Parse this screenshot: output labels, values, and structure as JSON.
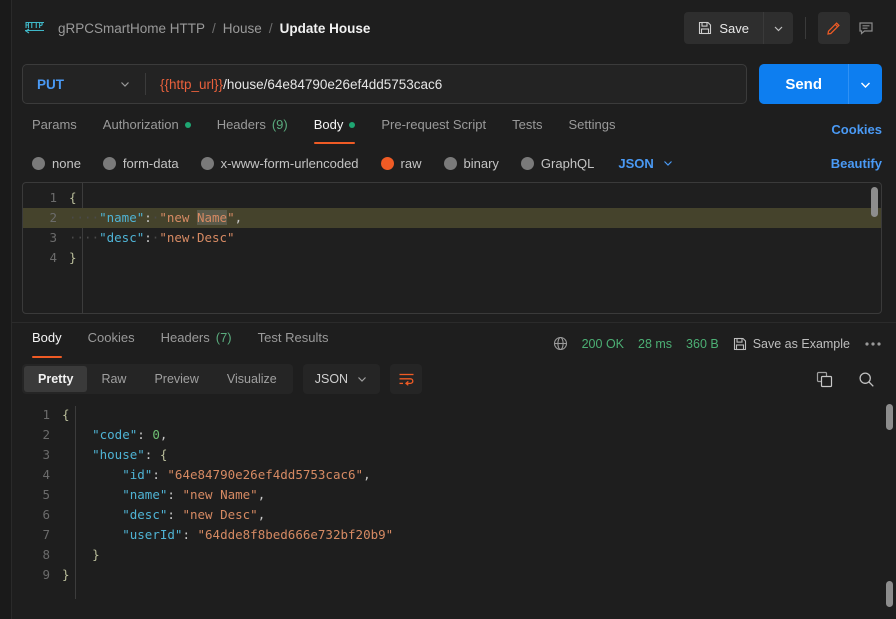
{
  "header": {
    "protocol_icon": "http-icon",
    "breadcrumb": [
      {
        "label": "gRPCSmartHome HTTP",
        "current": false
      },
      {
        "label": "House",
        "current": false
      },
      {
        "label": "Update House",
        "current": true
      }
    ],
    "separator": "/",
    "save_label": "Save",
    "save_icon": "floppy-disk-icon",
    "save_caret_icon": "chevron-down-icon",
    "edit_icon": "pencil-icon",
    "comment_icon": "comment-icon",
    "accent_orange": "#ef5b25",
    "accent_blue": "#0d7ef0"
  },
  "request": {
    "method": "PUT",
    "method_caret_icon": "chevron-down-icon",
    "url_variable": "{{http_url}}",
    "url_path": "/house/64e84790e26ef4dd5753cac6",
    "url_full": "{{http_url}}/house/64e84790e26ef4dd5753cac6",
    "send_label": "Send",
    "send_caret_icon": "chevron-down-icon",
    "tabs": [
      {
        "label": "Params",
        "active": false,
        "dot": false,
        "count": ""
      },
      {
        "label": "Authorization",
        "active": false,
        "dot": true,
        "count": ""
      },
      {
        "label": "Headers",
        "active": false,
        "dot": false,
        "count": "(9)"
      },
      {
        "label": "Body",
        "active": true,
        "dot": true,
        "count": ""
      },
      {
        "label": "Pre-request Script",
        "active": false,
        "dot": false,
        "count": ""
      },
      {
        "label": "Tests",
        "active": false,
        "dot": false,
        "count": ""
      },
      {
        "label": "Settings",
        "active": false,
        "dot": false,
        "count": ""
      }
    ],
    "cookies_link": "Cookies",
    "body_types": [
      {
        "label": "none",
        "selected": false
      },
      {
        "label": "form-data",
        "selected": false
      },
      {
        "label": "x-www-form-urlencoded",
        "selected": false
      },
      {
        "label": "raw",
        "selected": true
      },
      {
        "label": "binary",
        "selected": false
      },
      {
        "label": "GraphQL",
        "selected": false
      }
    ],
    "raw_format": "JSON",
    "raw_format_caret_icon": "chevron-down-icon",
    "beautify_label": "Beautify",
    "body_lines": [
      {
        "no": "1",
        "indent": "",
        "tokens": [
          {
            "t": "{",
            "c": "brace"
          }
        ],
        "highlight": false
      },
      {
        "no": "2",
        "indent": "····",
        "tokens": [
          {
            "t": "\"name\"",
            "c": "k"
          },
          {
            "t": ":",
            "c": "p"
          },
          {
            "t": "·",
            "c": "ws"
          },
          {
            "t": "\"new ",
            "c": "s"
          },
          {
            "t": "Name",
            "c": "s sel-text"
          },
          {
            "t": "\"",
            "c": "s"
          },
          {
            "t": ",",
            "c": "p"
          }
        ],
        "highlight": true
      },
      {
        "no": "3",
        "indent": "····",
        "tokens": [
          {
            "t": "\"desc\"",
            "c": "k"
          },
          {
            "t": ":",
            "c": "p"
          },
          {
            "t": "·",
            "c": "ws"
          },
          {
            "t": "\"new·Desc\"",
            "c": "s"
          }
        ],
        "highlight": false
      },
      {
        "no": "4",
        "indent": "",
        "tokens": [
          {
            "t": "}",
            "c": "brace"
          }
        ],
        "highlight": false
      }
    ]
  },
  "response": {
    "tabs": [
      {
        "label": "Body",
        "active": true,
        "count": ""
      },
      {
        "label": "Cookies",
        "active": false,
        "count": ""
      },
      {
        "label": "Headers",
        "active": false,
        "count": "(7)"
      },
      {
        "label": "Test Results",
        "active": false,
        "count": ""
      }
    ],
    "globe_icon": "globe-icon",
    "status": "200 OK",
    "time": "28 ms",
    "size": "360 B",
    "save_example_icon": "floppy-disk-icon",
    "save_example_label": "Save as Example",
    "more_icon": "ellipsis-icon",
    "view_modes": [
      {
        "label": "Pretty",
        "active": true
      },
      {
        "label": "Raw",
        "active": false
      },
      {
        "label": "Preview",
        "active": false
      },
      {
        "label": "Visualize",
        "active": false
      }
    ],
    "format": "JSON",
    "format_caret_icon": "chevron-down-icon",
    "wrap_icon": "wrap-lines-icon",
    "copy_icon": "copy-icon",
    "search_icon": "search-icon",
    "body_lines": [
      {
        "no": "1",
        "tokens": [
          {
            "t": "{",
            "c": "brace"
          }
        ]
      },
      {
        "no": "2",
        "tokens": [
          {
            "t": "    ",
            "c": "p"
          },
          {
            "t": "\"code\"",
            "c": "k"
          },
          {
            "t": ": ",
            "c": "p"
          },
          {
            "t": "0",
            "c": "n"
          },
          {
            "t": ",",
            "c": "p"
          }
        ]
      },
      {
        "no": "3",
        "tokens": [
          {
            "t": "    ",
            "c": "p"
          },
          {
            "t": "\"house\"",
            "c": "k"
          },
          {
            "t": ": ",
            "c": "p"
          },
          {
            "t": "{",
            "c": "brace"
          }
        ]
      },
      {
        "no": "4",
        "tokens": [
          {
            "t": "        ",
            "c": "p"
          },
          {
            "t": "\"id\"",
            "c": "k"
          },
          {
            "t": ": ",
            "c": "p"
          },
          {
            "t": "\"64e84790e26ef4dd5753cac6\"",
            "c": "s"
          },
          {
            "t": ",",
            "c": "p"
          }
        ]
      },
      {
        "no": "5",
        "tokens": [
          {
            "t": "        ",
            "c": "p"
          },
          {
            "t": "\"name\"",
            "c": "k"
          },
          {
            "t": ": ",
            "c": "p"
          },
          {
            "t": "\"new Name\"",
            "c": "s"
          },
          {
            "t": ",",
            "c": "p"
          }
        ]
      },
      {
        "no": "6",
        "tokens": [
          {
            "t": "        ",
            "c": "p"
          },
          {
            "t": "\"desc\"",
            "c": "k"
          },
          {
            "t": ": ",
            "c": "p"
          },
          {
            "t": "\"new Desc\"",
            "c": "s"
          },
          {
            "t": ",",
            "c": "p"
          }
        ]
      },
      {
        "no": "7",
        "tokens": [
          {
            "t": "        ",
            "c": "p"
          },
          {
            "t": "\"userId\"",
            "c": "k"
          },
          {
            "t": ": ",
            "c": "p"
          },
          {
            "t": "\"64dde8f8bed666e732bf20b9\"",
            "c": "s"
          }
        ]
      },
      {
        "no": "8",
        "tokens": [
          {
            "t": "    ",
            "c": "p"
          },
          {
            "t": "}",
            "c": "brace"
          }
        ]
      },
      {
        "no": "9",
        "tokens": [
          {
            "t": "}",
            "c": "brace"
          }
        ]
      }
    ]
  }
}
